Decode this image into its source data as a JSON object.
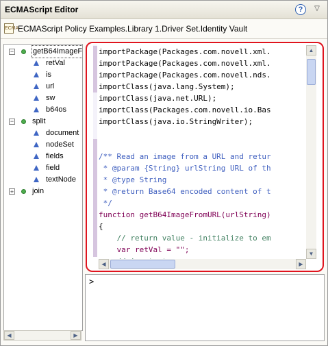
{
  "window": {
    "title": "ECMAScript Editor",
    "help_glyph": "?",
    "menu_glyph": "▽"
  },
  "path": {
    "icon_text": "ECMA",
    "text": "ECMAScript Policy Examples.Library 1.Driver Set.Identity Vault"
  },
  "tree": {
    "nodes": [
      {
        "label": "getB64ImageF",
        "expander": "−",
        "icon": "function-dot-icon"
      },
      {
        "label": "retVal",
        "icon": "variable-triangle-icon"
      },
      {
        "label": "is",
        "icon": "variable-triangle-icon"
      },
      {
        "label": "url",
        "icon": "variable-triangle-icon"
      },
      {
        "label": "sw",
        "icon": "variable-triangle-icon"
      },
      {
        "label": "b64os",
        "icon": "variable-triangle-icon"
      },
      {
        "label": "split",
        "expander": "−",
        "icon": "function-dot-icon"
      },
      {
        "label": "document",
        "icon": "variable-triangle-icon"
      },
      {
        "label": "nodeSet",
        "icon": "variable-triangle-icon"
      },
      {
        "label": "fields",
        "icon": "variable-triangle-icon"
      },
      {
        "label": "field",
        "icon": "variable-triangle-icon"
      },
      {
        "label": "textNode",
        "icon": "variable-triangle-icon"
      },
      {
        "label": "join",
        "expander": "+",
        "icon": "function-dot-icon"
      }
    ]
  },
  "editor": {
    "lines": [
      {
        "text": "importPackage(Packages.com.novell.xml.",
        "color": "#000000"
      },
      {
        "text": "importPackage(Packages.com.novell.xml.",
        "color": "#000000"
      },
      {
        "text": "importPackage(Packages.com.novell.nds.",
        "color": "#000000"
      },
      {
        "text": "importClass(java.lang.System);",
        "color": "#000000"
      },
      {
        "text": "importClass(java.net.URL);",
        "color": "#000000"
      },
      {
        "text": "importClass(Packages.com.novell.io.Bas",
        "color": "#000000"
      },
      {
        "text": "importClass(java.io.StringWriter);",
        "color": "#000000"
      },
      {
        "text": "",
        "color": "#000000"
      },
      {
        "text": "",
        "color": "#000000"
      },
      {
        "text": "/** Read an image from a URL and retur",
        "color": "#3f5fbf"
      },
      {
        "text": " * @param {String} urlString URL of th",
        "color": "#3f5fbf"
      },
      {
        "text": " * @type String",
        "color": "#3f5fbf"
      },
      {
        "text": " * @return Base64 encoded content of t",
        "color": "#3f5fbf"
      },
      {
        "text": " */",
        "color": "#3f5fbf"
      },
      {
        "text": "function getB64ImageFromURL(urlString)",
        "color": "#7f0055"
      },
      {
        "text": "{",
        "color": "#000000"
      },
      {
        "text": "    // return value - initialize to em",
        "color": "#3f7f5f"
      },
      {
        "text": "    var retVal = \"\";",
        "color": "#7f0055"
      },
      {
        "text": "    // input stream",
        "color": "#3f7f5f"
      }
    ],
    "scroll_up": "▲",
    "scroll_down": "▼",
    "scroll_left": "◀",
    "scroll_right": "▶"
  },
  "console": {
    "prompt": ">"
  },
  "tree_scroll": {
    "left": "◀",
    "right": "▶"
  }
}
